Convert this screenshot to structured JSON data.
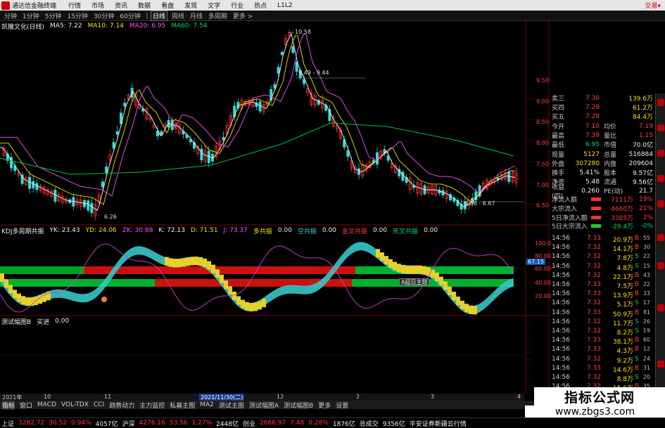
{
  "app": {
    "name": "通达信金融终端",
    "right_link": "交易▾"
  },
  "menu": [
    "行情",
    "市场",
    "资讯",
    "数据",
    "看盘",
    "发现",
    "文字",
    "行业",
    "热点",
    "L1L2"
  ],
  "periods": [
    "分钟",
    "1分钟",
    "5分钟",
    "15分钟",
    "30分钟",
    "60分钟",
    "日线",
    "周线",
    "月线",
    "多周期",
    "更多 >"
  ],
  "active_period": "日线",
  "main_chart": {
    "stock": "凯撒文化(日线)",
    "ma5": "MA5: 7.22",
    "ma10": "MA10: 7.14",
    "ma20": "MA20: 6.95",
    "ma60": "MA60: 7.54",
    "label_high": "10.58",
    "label_mid": "9.49 - 9.44",
    "label_low": "6.26",
    "label_right": "6.66 - 6.67"
  },
  "price_axis": [
    "9.50",
    "9.00",
    "8.50",
    "8.00",
    "7.50",
    "7.00",
    "6.50"
  ],
  "indicator1": {
    "name": "KDJ多周期共振",
    "yk": "YK: 23.43",
    "yd": "YD: 24.06",
    "zk": "ZK: 30.88",
    "k": "K: 72.13",
    "d": "D: 71.51",
    "j": "J: 73.37",
    "duo": "多共振",
    "kong": "空共振",
    "pdf": "金叉共振",
    "dead": "死叉共振",
    "v0": "0.00",
    "axis": [
      "100.0",
      "80.00",
      "60.00",
      "40.00",
      "20.00"
    ],
    "current": "67.15",
    "badge": "A超日主题"
  },
  "indicator2": {
    "name": "测试幅图B",
    "field": "买进",
    "value": "0.00"
  },
  "quote": [
    {
      "label": "卖三",
      "price": "7.30",
      "vol": "139.6万"
    },
    {
      "label": "买四",
      "price": "7.29",
      "vol": "61.2万"
    },
    {
      "label": "买五",
      "price": "7.28",
      "vol": "84.4万"
    },
    {
      "label": "今开",
      "price": "7.10",
      "extra_label": "均价",
      "extra": "7.19"
    },
    {
      "label": "最高",
      "price": "7.39",
      "extra_label": "量比",
      "extra": "1.15"
    },
    {
      "label": "最低",
      "price": "6.95",
      "extra_label": "市值",
      "extra": "70.0亿"
    },
    {
      "label": "现量",
      "price": "5127",
      "extra_label": "总量",
      "extra": "516884"
    },
    {
      "label": "外盘",
      "price": "307280",
      "extra_label": "内盘",
      "extra": "209604"
    },
    {
      "label": "换手",
      "price": "5.41%",
      "extra_label": "股本",
      "extra": "9.57亿"
    },
    {
      "label": "净资",
      "price": "5.48",
      "extra_label": "流通",
      "extra": "9.56亿"
    },
    {
      "label": "收益(四)",
      "price": "0.260",
      "extra_label": "PE(动)",
      "extra": "21.7"
    }
  ],
  "flows": [
    {
      "label": "净流入额",
      "value": "7111万",
      "pct": "19%"
    },
    {
      "label": "大宗流入",
      "value": "4660万",
      "pct": "21%"
    },
    {
      "label": "5日净流入额",
      "value": "3385万",
      "pct": "2%"
    },
    {
      "label": "5日大宗流入",
      "value": "-29.4万",
      "pct": "-0%"
    }
  ],
  "trades": [
    {
      "time": "14:56",
      "price": "7.33",
      "vol": "20.9万",
      "side": "B",
      "n": "55"
    },
    {
      "time": "14:56",
      "price": "7.32",
      "vol": "14.1万",
      "side": "B",
      "n": "30"
    },
    {
      "time": "14:56",
      "price": "7.32",
      "vol": "7.8万",
      "side": "S",
      "n": "22"
    },
    {
      "time": "14:56",
      "price": "7.32",
      "vol": "4.8万",
      "side": "S",
      "n": "15"
    },
    {
      "time": "14:56",
      "price": "7.32",
      "vol": "22.1万",
      "side": "B",
      "n": "43"
    },
    {
      "time": "14:56",
      "price": "7.33",
      "vol": "7.5万",
      "side": "B",
      "n": "22"
    },
    {
      "time": "14:56",
      "price": "7.33",
      "vol": "13.9万",
      "side": "B",
      "n": "33"
    },
    {
      "time": "14:56",
      "price": "7.32",
      "vol": "5.1万",
      "side": "S",
      "n": "17"
    },
    {
      "time": "14:56",
      "price": "7.33",
      "vol": "50.9万",
      "side": "B",
      "n": "81"
    },
    {
      "time": "14:56",
      "price": "7.32",
      "vol": "11.7万",
      "side": "S",
      "n": "26"
    },
    {
      "time": "14:56",
      "price": "7.32",
      "vol": "8.2万",
      "side": "S",
      "n": "19"
    },
    {
      "time": "14:56",
      "price": "7.33",
      "vol": "38.1万",
      "side": "B",
      "n": "60"
    },
    {
      "time": "14:56",
      "price": "7.33",
      "vol": "4.3万",
      "side": "B",
      "n": "12"
    },
    {
      "time": "14:56",
      "price": "7.32",
      "vol": "9.2万",
      "side": "S",
      "n": "24"
    },
    {
      "time": "14:56",
      "price": "7.33",
      "vol": "14.6万",
      "side": "B",
      "n": "31"
    },
    {
      "time": "14:56",
      "price": "7.32",
      "vol": "8.8万",
      "side": "S",
      "n": "20"
    },
    {
      "time": "14:56",
      "price": "7.32",
      "vol": "15.6万",
      "side": "B",
      "n": "35"
    },
    {
      "time": "14:56",
      "price": "7.33",
      "vol": "3.9万",
      "side": "B",
      "n": "11"
    }
  ],
  "date_axis": [
    "2021年",
    "10",
    "11",
    "2021/11/30(二)",
    "12",
    "2",
    "3",
    "4"
  ],
  "tabs": [
    "指标",
    "窗口",
    "MACD",
    "VOL-TDX",
    "CCI",
    "趋势动力",
    "主力监控",
    "私募主图",
    "MA2",
    "测试主图",
    "测试幅图A",
    "测试幅图B",
    "更多",
    "设置"
  ],
  "ticker": [
    {
      "name": "上证",
      "value": "3282.72",
      "chg": "30.52",
      "pct": "0.94%",
      "amt": "4057亿"
    },
    {
      "name": "沪深",
      "value": "4276.16",
      "chg": "53.56",
      "pct": "1.27%",
      "amt": "2448亿"
    },
    {
      "name": "创业",
      "value": "2666.97",
      "chg": "7.48",
      "pct": "0.28%",
      "amt": "1876亿"
    }
  ],
  "ticker_extra": {
    "label": "总成交",
    "value": "9356亿",
    "broker": "平安证券新疆云行情"
  },
  "watermark": {
    "title": "指标公式网",
    "url": "www.zbgs3.com"
  }
}
